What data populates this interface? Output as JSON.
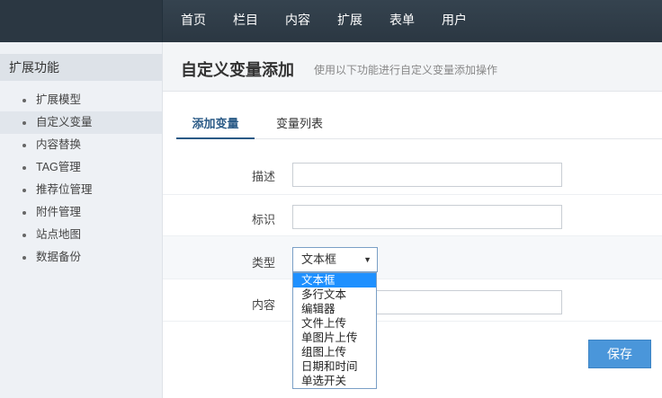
{
  "topnav": {
    "items": [
      "首页",
      "栏目",
      "内容",
      "扩展",
      "表单",
      "用户"
    ]
  },
  "sidebar": {
    "title": "扩展功能",
    "items": [
      {
        "label": "扩展模型"
      },
      {
        "label": "自定义变量",
        "active": true
      },
      {
        "label": "内容替换"
      },
      {
        "label": "TAG管理"
      },
      {
        "label": "推荐位管理"
      },
      {
        "label": "附件管理"
      },
      {
        "label": "站点地图"
      },
      {
        "label": "数据备份"
      }
    ]
  },
  "page": {
    "title": "自定义变量添加",
    "subtitle": "使用以下功能进行自定义变量添加操作"
  },
  "tabs": {
    "add": "添加变量",
    "list": "变量列表",
    "active": "add"
  },
  "form": {
    "desc_label": "描述",
    "desc_value": "",
    "ident_label": "标识",
    "ident_value": "",
    "type_label": "类型",
    "type_selected": "文本框",
    "type_options": [
      "文本框",
      "多行文本",
      "编辑器",
      "文件上传",
      "单图片上传",
      "组图上传",
      "日期和时间",
      "单选开关"
    ],
    "content_label": "内容",
    "content_value": ""
  },
  "buttons": {
    "save": "保存"
  },
  "colors": {
    "topbar": "#2b3742",
    "accent": "#4a96da",
    "tab_active": "#2a5a86",
    "dropdown_highlight": "#1e90ff"
  }
}
